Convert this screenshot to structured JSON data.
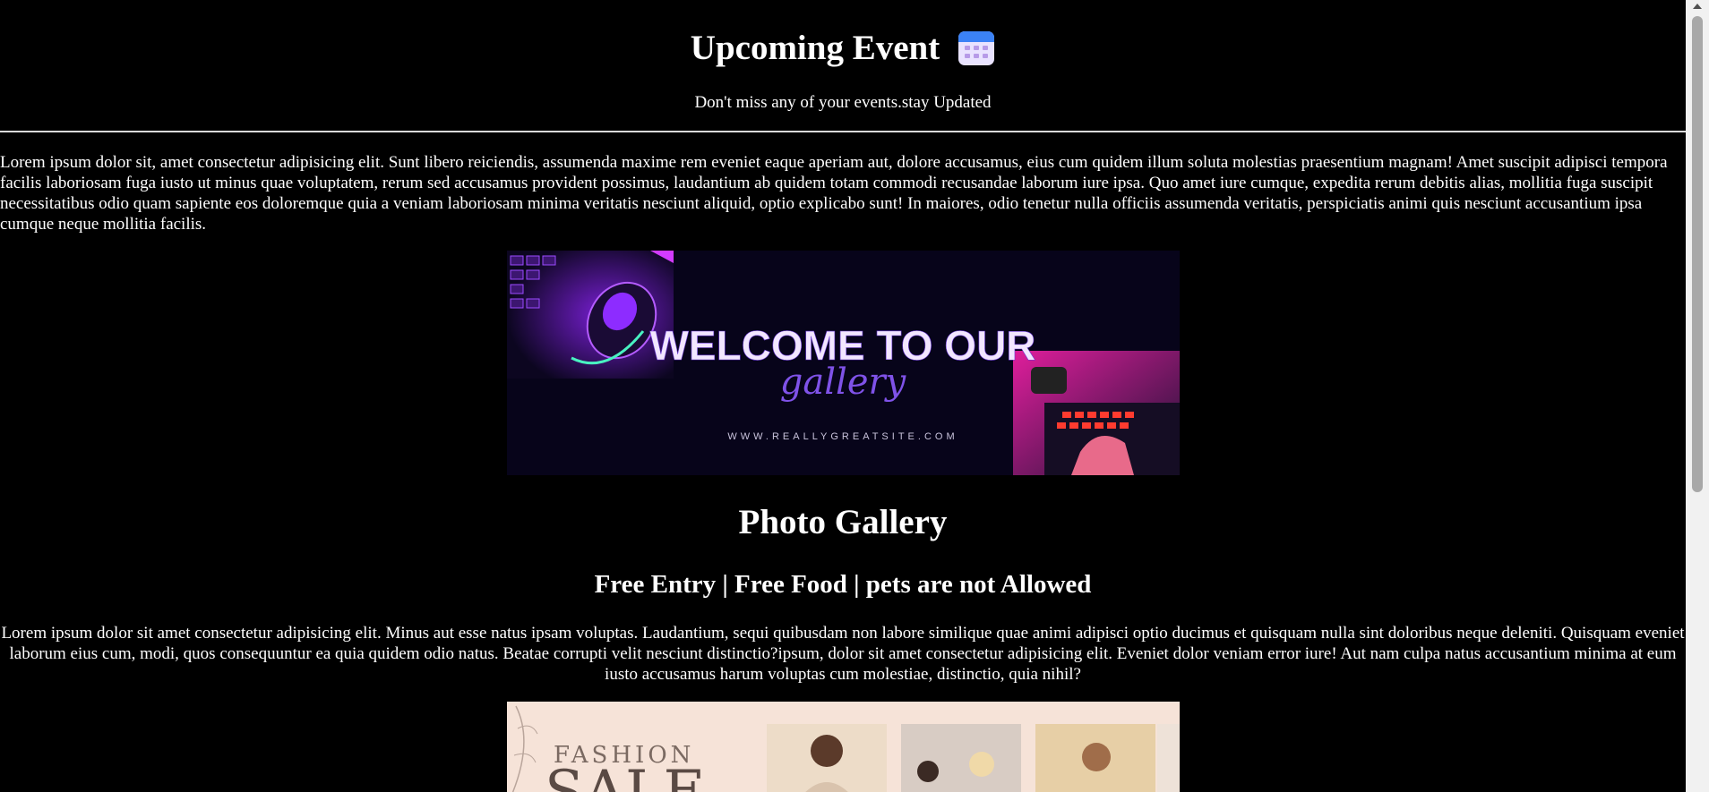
{
  "header": {
    "title": "Upcoming Event",
    "subtitle": "Don't miss any of your events.stay Updated"
  },
  "intro": {
    "text": "Lorem ipsum dolor sit, amet consectetur adipisicing elit. Sunt libero reiciendis, assumenda maxime rem eveniet eaque aperiam aut, dolore accusamus, eius cum quidem illum soluta molestias praesentium magnam! Amet suscipit adipisci tempora facilis laboriosam fuga iusto ut minus quae voluptatem, rerum sed accusamus provident possimus, laudantium ab quidem totam commodi recusandae laborum iure ipsa. Quo amet iure cumque, expedita rerum debitis alias, mollitia fuga suscipit necessitatibus odio quam sapiente eos doloremque quia a veniam laboriosam minima veritatis nesciunt aliquid, optio explicabo sunt! In maiores, odio tenetur nulla officiis assumenda veritatis, perspiciatis animi quis nesciunt accusantium ipsa cumque neque mollitia facilis."
  },
  "banner": {
    "headline": "WELCOME TO OUR",
    "script": "gallery",
    "url": "WWW.REALLYGREATSITE.COM"
  },
  "gallery": {
    "title": "Photo Gallery",
    "info": "Free Entry | Free Food | pets are not Allowed",
    "text": "Lorem ipsum dolor sit amet consectetur adipisicing elit. Minus aut esse natus ipsam voluptas. Laudantium, sequi quibusdam non labore similique quae animi adipisci optio ducimus et quisquam nulla sint doloribus neque deleniti. Quisquam eveniet laborum eius cum, modi, quos consequuntur ea quia quidem odio natus. Beatae corrupti velit nesciunt distinctio?ipsum, dolor sit amet consectetur adipisicing elit. Eveniet dolor veniam error iure! Aut nam culpa natus accusantium minima at eum iusto accusamus harum voluptas cum molestiae, distinctio, quia nihil?"
  },
  "fashion": {
    "word1": "FASHION",
    "word2": "SALE"
  },
  "icons": {
    "calendar": "calendar-icon"
  },
  "colors": {
    "background": "#000000",
    "text": "#ffffff",
    "banner_bg": "#07041a",
    "banner_accent": "#b03cff",
    "fashion_bg": "#f6e3d8"
  }
}
